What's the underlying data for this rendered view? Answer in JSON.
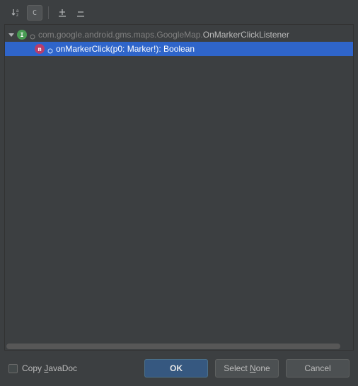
{
  "toolbar": {
    "sort_alpha": "↓A-Z",
    "show_classes": "C",
    "expand_all": "expand",
    "collapse_all": "collapse"
  },
  "tree": {
    "root": {
      "package": "com.google.android.gms.maps.GoogleMap.",
      "class": "OnMarkerClickListener"
    },
    "method": {
      "signature": "onMarkerClick(p0: Marker!): Boolean"
    }
  },
  "footer": {
    "copy_javadoc_prefix": "Copy ",
    "copy_javadoc_mnemonic": "J",
    "copy_javadoc_suffix": "avaDoc",
    "ok": "OK",
    "select_none_prefix": "Select ",
    "select_none_mnemonic": "N",
    "select_none_suffix": "one",
    "cancel": "Cancel"
  }
}
